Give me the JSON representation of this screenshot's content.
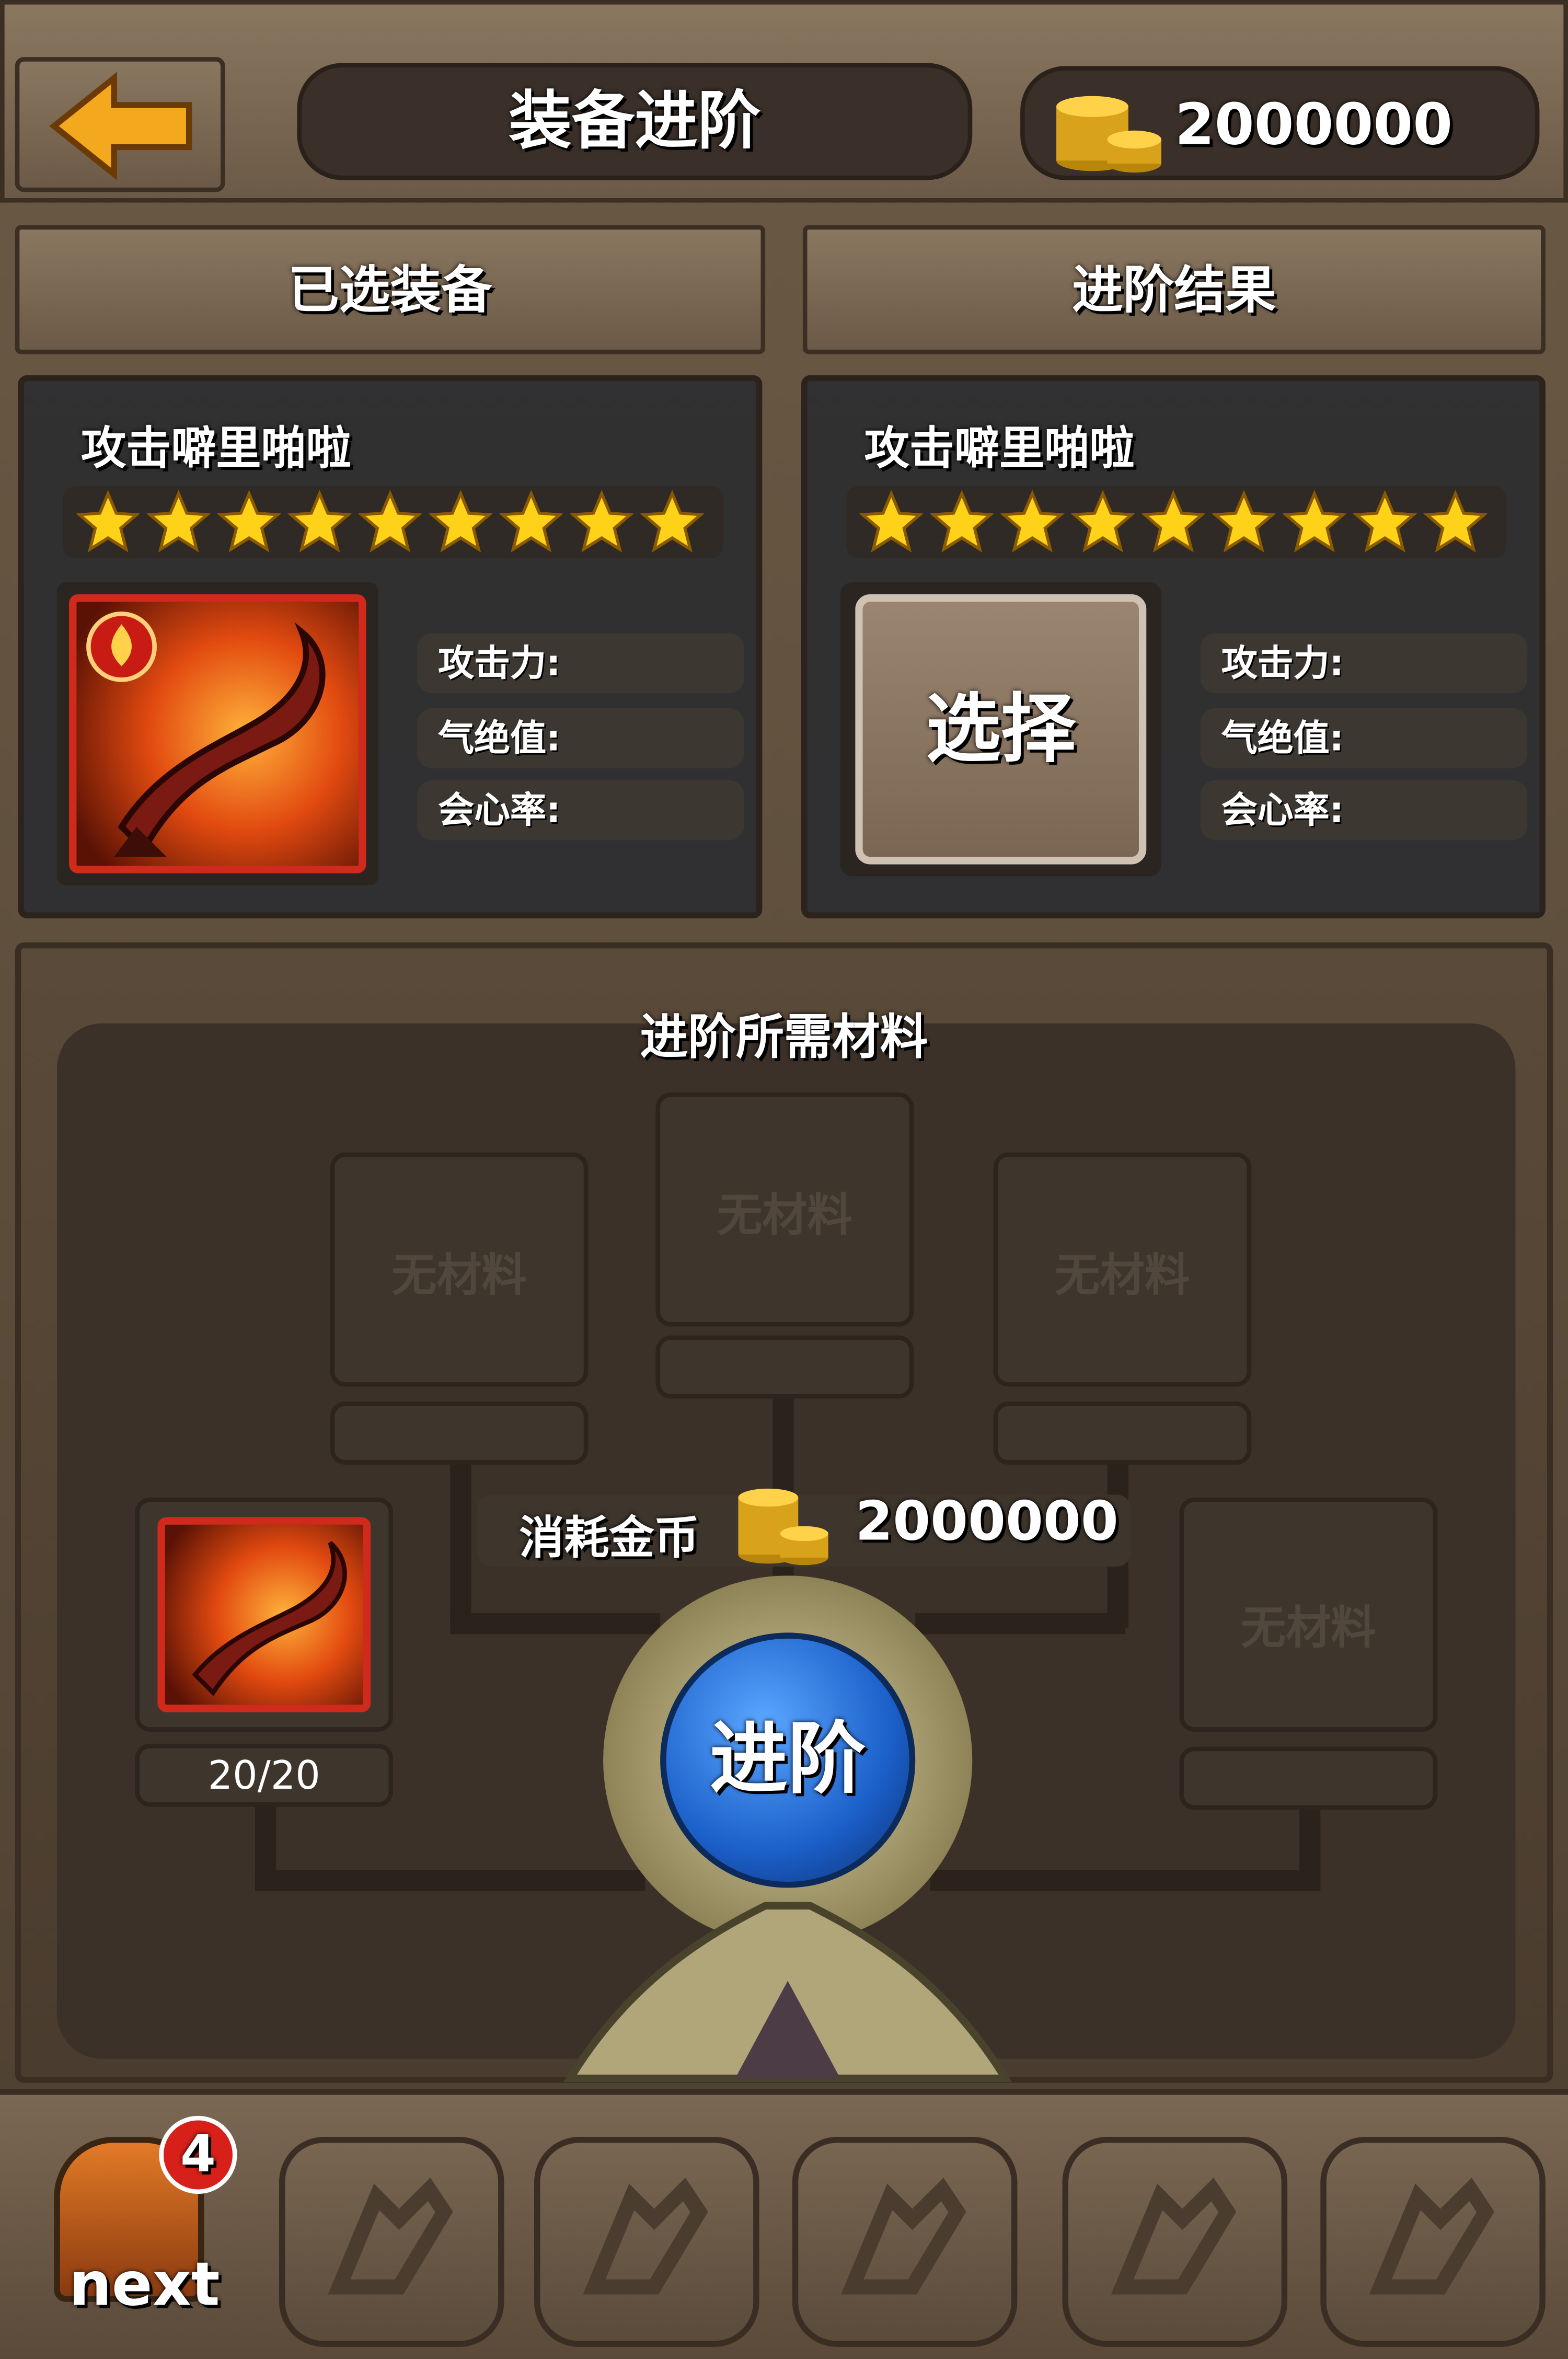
{
  "header": {
    "title": "装备进阶",
    "coins": "2000000",
    "colors": {
      "accent_gold": "#f0b020",
      "back_arrow": "#f4a81e"
    }
  },
  "tabs": {
    "selected": "已选装备",
    "result": "进阶结果"
  },
  "selected_item": {
    "name": "攻击噼里啪啦",
    "stars": 9,
    "stats": [
      "攻击力:",
      "气绝值:",
      "会心率:"
    ]
  },
  "result_item": {
    "name": "攻击噼里啪啦",
    "stars": 9,
    "select_label": "选择",
    "stats": [
      "攻击力:",
      "气绝值:",
      "会心率:"
    ]
  },
  "materials": {
    "title": "进阶所需材料",
    "empty_label": "无材料",
    "owned_count": "20/20",
    "cost_label": "消耗金币",
    "cost_value": "2000000"
  },
  "upgrade_button": "进阶",
  "bottom_bar": {
    "next_label": "next",
    "badge": "4"
  }
}
